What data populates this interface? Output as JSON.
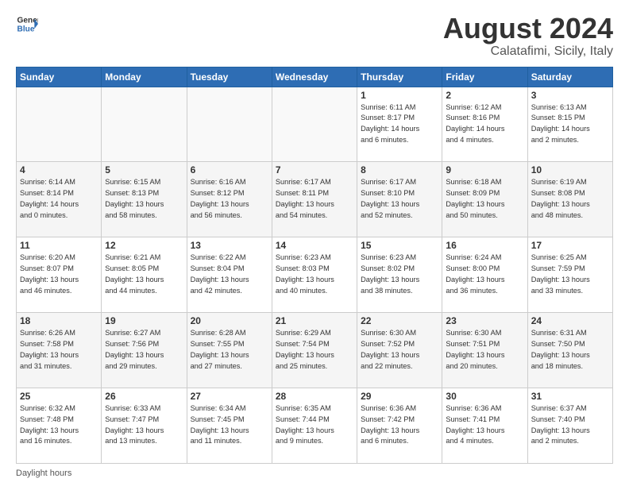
{
  "header": {
    "logo_line1": "General",
    "logo_line2": "Blue",
    "main_title": "August 2024",
    "subtitle": "Calatafimi, Sicily, Italy"
  },
  "days_of_week": [
    "Sunday",
    "Monday",
    "Tuesday",
    "Wednesday",
    "Thursday",
    "Friday",
    "Saturday"
  ],
  "weeks": [
    [
      {
        "num": "",
        "info": ""
      },
      {
        "num": "",
        "info": ""
      },
      {
        "num": "",
        "info": ""
      },
      {
        "num": "",
        "info": ""
      },
      {
        "num": "1",
        "info": "Sunrise: 6:11 AM\nSunset: 8:17 PM\nDaylight: 14 hours\nand 6 minutes."
      },
      {
        "num": "2",
        "info": "Sunrise: 6:12 AM\nSunset: 8:16 PM\nDaylight: 14 hours\nand 4 minutes."
      },
      {
        "num": "3",
        "info": "Sunrise: 6:13 AM\nSunset: 8:15 PM\nDaylight: 14 hours\nand 2 minutes."
      }
    ],
    [
      {
        "num": "4",
        "info": "Sunrise: 6:14 AM\nSunset: 8:14 PM\nDaylight: 14 hours\nand 0 minutes."
      },
      {
        "num": "5",
        "info": "Sunrise: 6:15 AM\nSunset: 8:13 PM\nDaylight: 13 hours\nand 58 minutes."
      },
      {
        "num": "6",
        "info": "Sunrise: 6:16 AM\nSunset: 8:12 PM\nDaylight: 13 hours\nand 56 minutes."
      },
      {
        "num": "7",
        "info": "Sunrise: 6:17 AM\nSunset: 8:11 PM\nDaylight: 13 hours\nand 54 minutes."
      },
      {
        "num": "8",
        "info": "Sunrise: 6:17 AM\nSunset: 8:10 PM\nDaylight: 13 hours\nand 52 minutes."
      },
      {
        "num": "9",
        "info": "Sunrise: 6:18 AM\nSunset: 8:09 PM\nDaylight: 13 hours\nand 50 minutes."
      },
      {
        "num": "10",
        "info": "Sunrise: 6:19 AM\nSunset: 8:08 PM\nDaylight: 13 hours\nand 48 minutes."
      }
    ],
    [
      {
        "num": "11",
        "info": "Sunrise: 6:20 AM\nSunset: 8:07 PM\nDaylight: 13 hours\nand 46 minutes."
      },
      {
        "num": "12",
        "info": "Sunrise: 6:21 AM\nSunset: 8:05 PM\nDaylight: 13 hours\nand 44 minutes."
      },
      {
        "num": "13",
        "info": "Sunrise: 6:22 AM\nSunset: 8:04 PM\nDaylight: 13 hours\nand 42 minutes."
      },
      {
        "num": "14",
        "info": "Sunrise: 6:23 AM\nSunset: 8:03 PM\nDaylight: 13 hours\nand 40 minutes."
      },
      {
        "num": "15",
        "info": "Sunrise: 6:23 AM\nSunset: 8:02 PM\nDaylight: 13 hours\nand 38 minutes."
      },
      {
        "num": "16",
        "info": "Sunrise: 6:24 AM\nSunset: 8:00 PM\nDaylight: 13 hours\nand 36 minutes."
      },
      {
        "num": "17",
        "info": "Sunrise: 6:25 AM\nSunset: 7:59 PM\nDaylight: 13 hours\nand 33 minutes."
      }
    ],
    [
      {
        "num": "18",
        "info": "Sunrise: 6:26 AM\nSunset: 7:58 PM\nDaylight: 13 hours\nand 31 minutes."
      },
      {
        "num": "19",
        "info": "Sunrise: 6:27 AM\nSunset: 7:56 PM\nDaylight: 13 hours\nand 29 minutes."
      },
      {
        "num": "20",
        "info": "Sunrise: 6:28 AM\nSunset: 7:55 PM\nDaylight: 13 hours\nand 27 minutes."
      },
      {
        "num": "21",
        "info": "Sunrise: 6:29 AM\nSunset: 7:54 PM\nDaylight: 13 hours\nand 25 minutes."
      },
      {
        "num": "22",
        "info": "Sunrise: 6:30 AM\nSunset: 7:52 PM\nDaylight: 13 hours\nand 22 minutes."
      },
      {
        "num": "23",
        "info": "Sunrise: 6:30 AM\nSunset: 7:51 PM\nDaylight: 13 hours\nand 20 minutes."
      },
      {
        "num": "24",
        "info": "Sunrise: 6:31 AM\nSunset: 7:50 PM\nDaylight: 13 hours\nand 18 minutes."
      }
    ],
    [
      {
        "num": "25",
        "info": "Sunrise: 6:32 AM\nSunset: 7:48 PM\nDaylight: 13 hours\nand 16 minutes."
      },
      {
        "num": "26",
        "info": "Sunrise: 6:33 AM\nSunset: 7:47 PM\nDaylight: 13 hours\nand 13 minutes."
      },
      {
        "num": "27",
        "info": "Sunrise: 6:34 AM\nSunset: 7:45 PM\nDaylight: 13 hours\nand 11 minutes."
      },
      {
        "num": "28",
        "info": "Sunrise: 6:35 AM\nSunset: 7:44 PM\nDaylight: 13 hours\nand 9 minutes."
      },
      {
        "num": "29",
        "info": "Sunrise: 6:36 AM\nSunset: 7:42 PM\nDaylight: 13 hours\nand 6 minutes."
      },
      {
        "num": "30",
        "info": "Sunrise: 6:36 AM\nSunset: 7:41 PM\nDaylight: 13 hours\nand 4 minutes."
      },
      {
        "num": "31",
        "info": "Sunrise: 6:37 AM\nSunset: 7:40 PM\nDaylight: 13 hours\nand 2 minutes."
      }
    ]
  ],
  "footer": {
    "daylight_label": "Daylight hours"
  }
}
